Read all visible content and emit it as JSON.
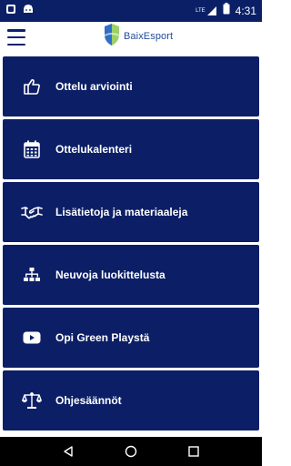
{
  "status_bar": {
    "time": "4:31",
    "network_label": "LTE"
  },
  "header": {
    "logo_text": "BaixEsport"
  },
  "menu": {
    "items": [
      {
        "label": "Ottelu arviointi",
        "icon": "thumbs-up-icon"
      },
      {
        "label": "Ottelukalenteri",
        "icon": "calendar-icon"
      },
      {
        "label": "Lisätietoja ja materiaaleja",
        "icon": "handshake-icon"
      },
      {
        "label": "Neuvoja luokittelusta",
        "icon": "sitemap-icon"
      },
      {
        "label": "Opi Green Playstä",
        "icon": "youtube-icon"
      },
      {
        "label": "Ohjesäännöt",
        "icon": "balance-scale-icon"
      }
    ]
  },
  "colors": {
    "primary": "#0c1f66",
    "status_bar": "#0b1f66",
    "text_on_primary": "#ffffff"
  }
}
